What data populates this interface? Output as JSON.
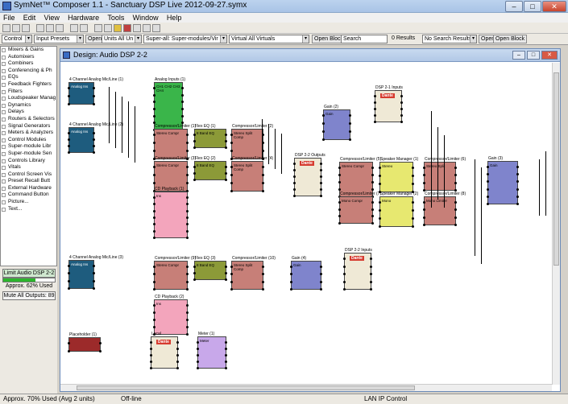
{
  "window": {
    "title": "SymNet™ Composer 1.1 - Sanctuary DSP Live 2012-09-27.symx",
    "minimize": "–",
    "maximize": "□",
    "close": "✕"
  },
  "menu": [
    "File",
    "Edit",
    "View",
    "Hardware",
    "Tools",
    "Window",
    "Help"
  ],
  "toolbar2": {
    "control": "Control",
    "input_presets": "Input Presets",
    "open1": "Open",
    "units": "Units All Un",
    "super_all": "Super-all: Super-modules/Vir",
    "virtual_all": "Virtual All Virtuals",
    "open_block": "Open Block",
    "search_label": "Search",
    "search_value": "",
    "results": "0 Results",
    "no_search": "No Search Results",
    "open2": "Open",
    "open_block2": "Open Block"
  },
  "tree": [
    "Mixers & Gains",
    "Automixers",
    "Combiners",
    "Conferencing & Ph",
    "EQs",
    "Feedback Fighters",
    "Filters",
    "Loudspeaker Manag",
    "Dynamics",
    "Delays",
    "Routers & Selectors",
    "Signal Generators",
    "Meters & Analyzers",
    "Control Modules",
    "Super-module Libr",
    "Super-module Sen",
    "Controls Library",
    "Vitals",
    "Control Screen Vis",
    "Preset Recall Butt",
    "External Hardware",
    "Command Button",
    "Picture...",
    "Text..."
  ],
  "left_bottom": {
    "audio_button": "Limit Audio DSP 2-2",
    "usage": "Approx. 62% Used",
    "usage_pct": 62,
    "mute_button": "Mute All Outputs: 89"
  },
  "design": {
    "title": "Design: Audio DSP 2-2",
    "min": "–",
    "max": "□",
    "close": "✕"
  },
  "modules": [
    {
      "label": "4 Channel Analog Mic/Line (1)",
      "text": "Analog Ins",
      "color": "teal"
    },
    {
      "label": "Analog Inputs (1)",
      "text": "CH1 CH2 CH3 CH4",
      "color": "green"
    },
    {
      "label": "4 Channel Analog Mic/Line (2)",
      "text": "Analog Ins",
      "color": "teal"
    },
    {
      "label": "Compressor/Limiter (1)",
      "text": "Stereo Compr",
      "color": "rose"
    },
    {
      "label": "Flex EQ (1)",
      "text": "8 Band EQ",
      "color": "olive"
    },
    {
      "label": "Compressor/Limiter (2)",
      "text": "Stereo Split Comp",
      "color": "rose"
    },
    {
      "label": "Gain (2)",
      "text": "Gain",
      "color": "blue"
    },
    {
      "label": "DSP 2-1 Inputs",
      "text": "Dante",
      "color": "cream"
    },
    {
      "label": "Compressor/Limiter (3)",
      "text": "Stereo Compr",
      "color": "rose"
    },
    {
      "label": "Flex EQ (2)",
      "text": "8 Band EQ",
      "color": "olive"
    },
    {
      "label": "Compressor/Limiter (4)",
      "text": "Stereo Split Comp",
      "color": "rose"
    },
    {
      "label": "DSP 2-2 Outputs",
      "text": "Dante",
      "color": "cream"
    },
    {
      "label": "Compressor/Limiter (5)",
      "text": "Stereo Compr",
      "color": "rose"
    },
    {
      "label": "Speaker Manager (1)",
      "text": "Stereo",
      "color": "yellow"
    },
    {
      "label": "Compressor/Limiter (6)",
      "text": "Stereo Split",
      "color": "rose"
    },
    {
      "label": "Gain (3)",
      "text": "Gain",
      "color": "blue"
    },
    {
      "label": "CD Playback (1)",
      "text": "Ins",
      "color": "pink"
    },
    {
      "label": "Compressor/Limiter (7)",
      "text": "Mono Compr",
      "color": "rose"
    },
    {
      "label": "Speaker Manager (2)",
      "text": "Mono",
      "color": "yellow"
    },
    {
      "label": "Compressor/Limiter (8)",
      "text": "Mono Limiter",
      "color": "rose"
    },
    {
      "label": "4 Channel Analog Mic/Line (3)",
      "text": "Analog Ins",
      "color": "teal"
    },
    {
      "label": "Compressor/Limiter (9)",
      "text": "Stereo Compr",
      "color": "rose"
    },
    {
      "label": "Flex EQ (3)",
      "text": "8 Band EQ",
      "color": "olive"
    },
    {
      "label": "Compressor/Limiter (10)",
      "text": "Stereo Split Comp",
      "color": "rose"
    },
    {
      "label": "Gain (4)",
      "text": "Gain",
      "color": "blue"
    },
    {
      "label": "DSP 2-2 Inputs",
      "text": "Dante",
      "color": "cream"
    },
    {
      "label": "CD Playback (2)",
      "text": "Ins",
      "color": "pink"
    },
    {
      "label": "Placeholder (1)",
      "text": "",
      "color": "darkred"
    },
    {
      "label": "Local",
      "text": "Dante",
      "color": "cream"
    },
    {
      "label": "Meter (1)",
      "text": "Meter",
      "color": "violet"
    }
  ],
  "status": {
    "usage": "Approx. 70% Used (Avg 2 units)",
    "mode": "Off-line",
    "control": "LAN IP Control"
  }
}
